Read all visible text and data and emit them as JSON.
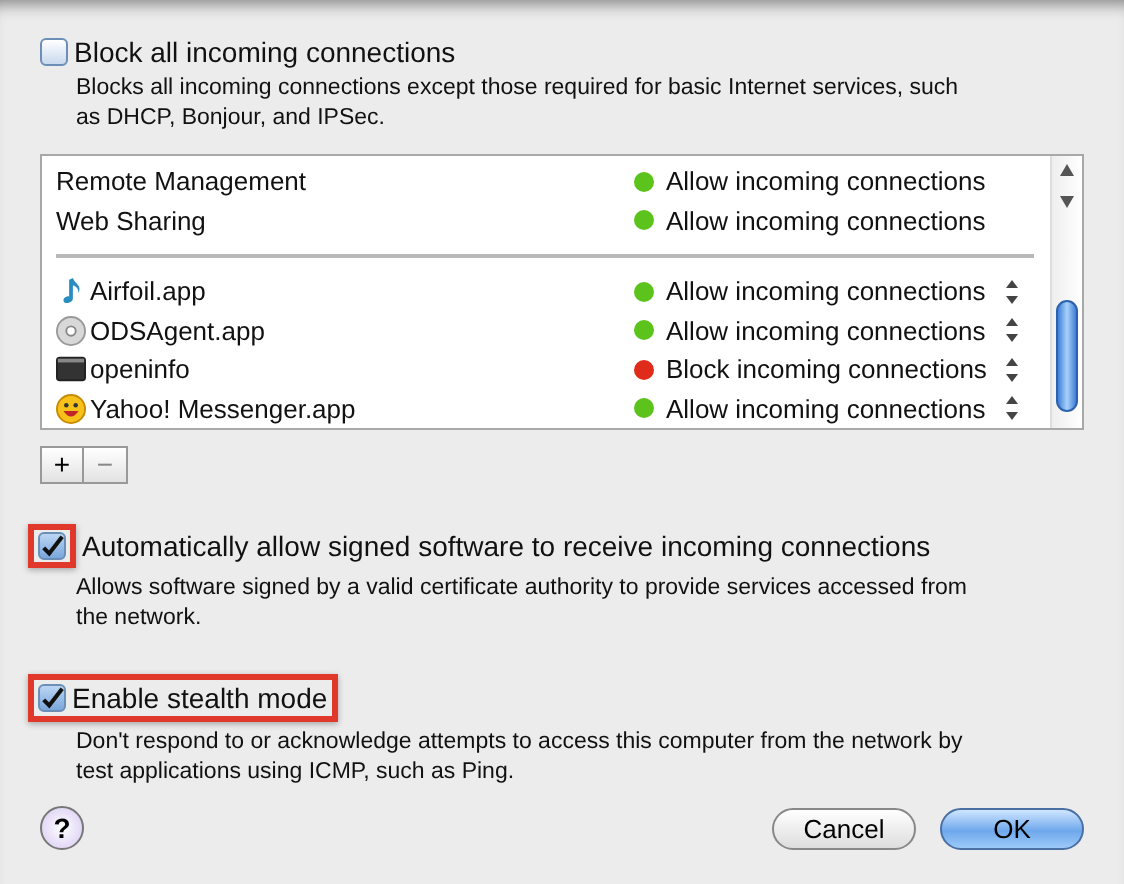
{
  "options_top": [
    {
      "label": "Block all incoming connections",
      "checked": false,
      "description": "Blocks all incoming connections except those required for basic Internet services, such as DHCP, Bonjour, and IPSec."
    }
  ],
  "connections": [
    {
      "kind": "service",
      "name": "Remote Management",
      "color": "#5cc21c",
      "status": "Allow incoming connections"
    },
    {
      "kind": "service",
      "name": "Web Sharing",
      "color": "#5cc21c",
      "status": "Allow incoming connections"
    },
    {
      "kind": "app",
      "name": "Airfoil.app",
      "color": "#5cc21c",
      "status": "Allow incoming connections"
    },
    {
      "kind": "app",
      "name": "ODSAgent.app",
      "color": "#5cc21c",
      "status": "Allow incoming connections"
    },
    {
      "kind": "app",
      "name": "openinfo",
      "color": "#e02a1a",
      "status": "Block incoming connections"
    },
    {
      "kind": "app",
      "name": "Yahoo! Messenger.app",
      "color": "#5cc21c",
      "status": "Allow incoming connections"
    }
  ],
  "list_buttons": [
    "+",
    "−"
  ],
  "options": [
    {
      "label": "Automatically allow signed software to receive incoming connections",
      "checked": true,
      "highlighted": true,
      "highlight_includes_label": false,
      "description": "Allows software signed by a valid certificate authority to provide services accessed from the network."
    },
    {
      "label": "Enable stealth mode",
      "checked": true,
      "highlighted": true,
      "highlight_includes_label": true,
      "description": "Don't respond to or acknowledge attempts to access this computer from the network by test applications using ICMP, such as Ping."
    }
  ],
  "help": "?",
  "buttons": [
    {
      "label": "Cancel",
      "default": false
    },
    {
      "label": "OK",
      "default": true
    }
  ]
}
